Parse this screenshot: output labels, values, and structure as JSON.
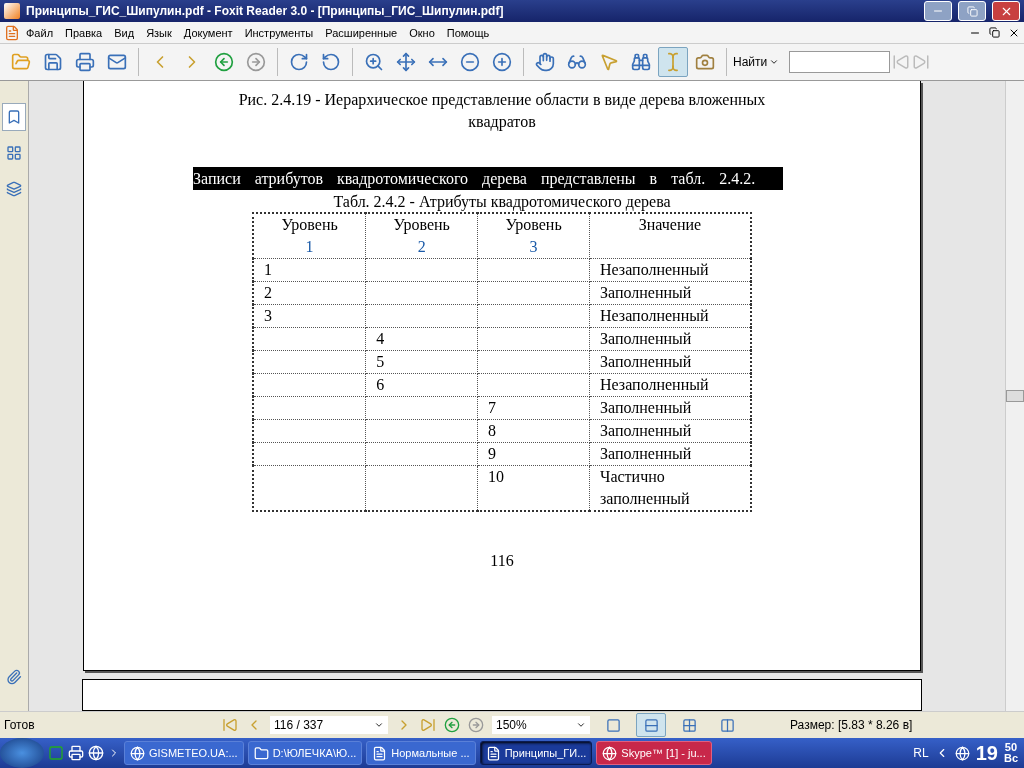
{
  "window": {
    "title": "Принципы_ГИС_Шипулин.pdf - Foxit Reader 3.0 - [Принципы_ГИС_Шипулин.pdf]"
  },
  "menu": [
    "Файл",
    "Правка",
    "Вид",
    "Язык",
    "Документ",
    "Инструменты",
    "Расширенные",
    "Окно",
    "Помощь"
  ],
  "tools": [
    {
      "kind": "open",
      "selected": false
    },
    {
      "kind": "save",
      "selected": false
    },
    {
      "kind": "print",
      "selected": false
    },
    {
      "kind": "email",
      "selected": false
    },
    {
      "kind": "prev",
      "selected": false
    },
    {
      "kind": "next",
      "selected": false
    },
    {
      "kind": "back",
      "selected": false
    },
    {
      "kind": "forward",
      "selected": false
    },
    {
      "kind": "rotate-cw",
      "selected": false
    },
    {
      "kind": "rotate-ccw",
      "selected": false
    },
    {
      "kind": "zoom-in",
      "selected": false
    },
    {
      "kind": "fit-page",
      "selected": false
    },
    {
      "kind": "fit-width",
      "selected": false
    },
    {
      "kind": "zoom-out",
      "selected": false
    },
    {
      "kind": "zoom-plus",
      "selected": false
    },
    {
      "kind": "hand",
      "selected": false
    },
    {
      "kind": "reader",
      "selected": false
    },
    {
      "kind": "select",
      "selected": false
    },
    {
      "kind": "find",
      "selected": false
    },
    {
      "kind": "text",
      "selected": true
    },
    {
      "kind": "snapshot",
      "selected": false
    }
  ],
  "find": {
    "label": "Найти"
  },
  "sidebar": [
    {
      "kind": "bookmarks",
      "selected": true
    },
    {
      "kind": "pages",
      "selected": false
    },
    {
      "kind": "layers",
      "selected": false
    },
    {
      "kind": "attachments",
      "selected": false
    }
  ],
  "page": {
    "caption": "Рис. 2.4.19 - Иерархическое представление области в виде дерева вложенных квадратов",
    "paragraph": {
      "text": "Записи атрибутов квадротомического дерева представлены в табл. 2.4.2.",
      "selected": true
    },
    "table_caption": "Табл. 2.4.2 - Атрибуты квадротомического дерева",
    "columns": [
      {
        "label": "Уровень",
        "number": "1"
      },
      {
        "label": "Уровень",
        "number": "2"
      },
      {
        "label": "Уровень",
        "number": "3"
      },
      {
        "label": "Значение"
      }
    ],
    "rows": [
      {
        "level_1": "1",
        "value": "Незаполненный"
      },
      {
        "level_1": "2",
        "value": "Заполненный"
      },
      {
        "level_1": "3",
        "value": "Незаполненный"
      },
      {
        "level_2": "4",
        "value": "Заполненный"
      },
      {
        "level_2": "5",
        "value": "Заполненный"
      },
      {
        "level_2": "6",
        "value": "Незаполненный"
      },
      {
        "level_3": "7",
        "value": "Заполненный"
      },
      {
        "level_3": "8",
        "value": "Заполненный"
      },
      {
        "level_3": "9",
        "value": "Заполненный"
      },
      {
        "level_3": "10",
        "value": "Частично заполненный"
      }
    ],
    "page_number": "116"
  },
  "status_bar": {
    "status": "Готов",
    "page_field": "116 / 337",
    "zoom_field": "150%",
    "size": "Размер: [5.83 * 8.26 в]",
    "layouts": [
      {
        "kind": "single",
        "selected": false
      },
      {
        "kind": "continuous",
        "selected": true
      },
      {
        "kind": "facing-continuous",
        "selected": false
      },
      {
        "kind": "facing",
        "selected": false
      }
    ]
  },
  "taskbar": {
    "items": [
      {
        "kind": "opera",
        "label": "GISMETEO.UA:...",
        "selected": false,
        "alert": false
      },
      {
        "kind": "folder",
        "label": "D:\\ЮЛЕЧКА\\Ю...",
        "selected": false,
        "alert": false
      },
      {
        "kind": "word",
        "label": "Нормальные ...",
        "selected": false,
        "alert": false
      },
      {
        "kind": "foxit",
        "label": "Принципы_ГИ...",
        "selected": true,
        "alert": false
      },
      {
        "kind": "skype",
        "label": "Skype™ [1] - ju...",
        "selected": false,
        "alert": true
      }
    ],
    "language": "RL",
    "clock_hours": "19",
    "clock_minutes": "50",
    "clock_day": "Вс"
  }
}
